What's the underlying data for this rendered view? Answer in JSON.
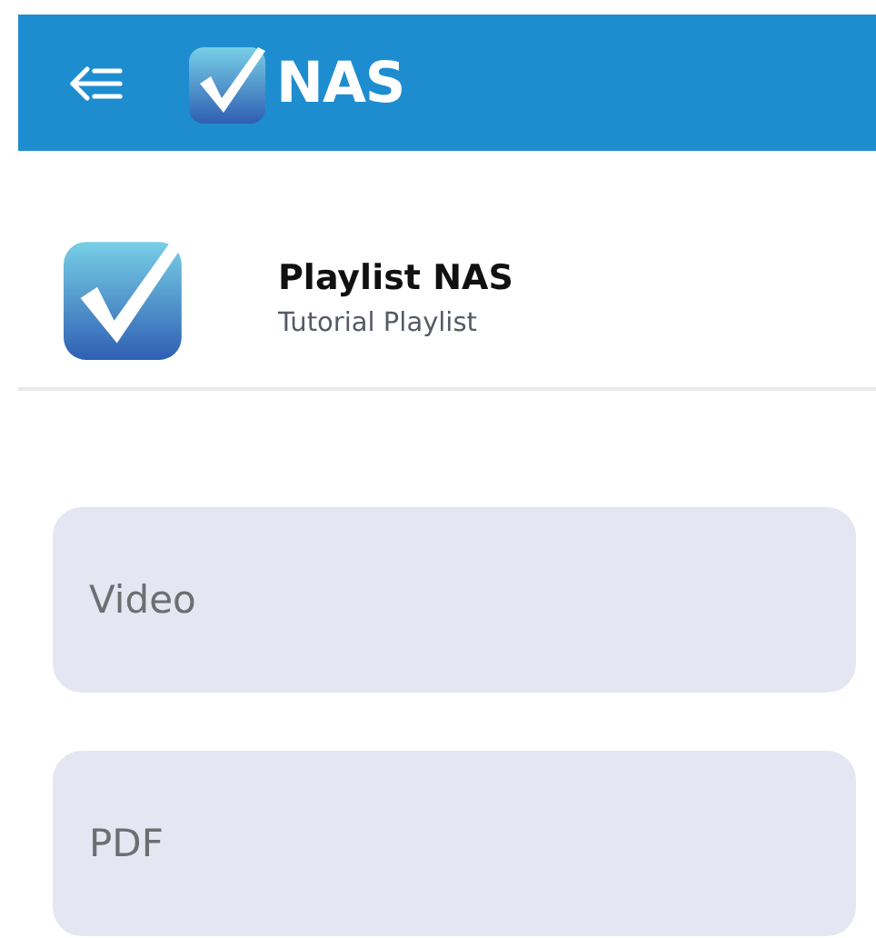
{
  "header": {
    "title": "NAS"
  },
  "playlist": {
    "title": "Playlist NAS",
    "subtitle": "Tutorial Playlist"
  },
  "options": [
    {
      "label": "Video"
    },
    {
      "label": "PDF"
    }
  ]
}
